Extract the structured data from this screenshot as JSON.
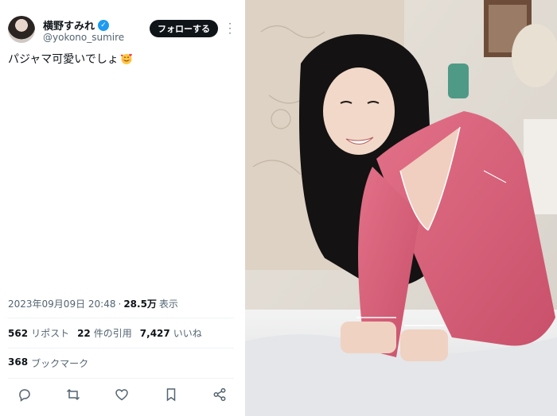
{
  "user": {
    "display_name": "横野すみれ",
    "handle": "@yokono_sumire",
    "verified_icon": "verified-badge-icon"
  },
  "follow_label": "フォローする",
  "tweet": {
    "text": "パジャマ可愛いでしょ",
    "emoji": "smiling-face-with-hearts"
  },
  "meta": {
    "timestamp": "2023年09月09日 20:48",
    "separator": "·",
    "views": "28.5万",
    "views_label": "表示"
  },
  "stats": {
    "reposts": "562",
    "reposts_label": "リポスト",
    "quotes": "22",
    "quotes_label": "件の引用",
    "likes": "7,427",
    "likes_label": "いいね"
  },
  "bookmarks": {
    "count": "368",
    "label": "ブックマーク"
  },
  "actions": [
    "reply-icon",
    "repost-icon",
    "like-icon",
    "bookmark-icon",
    "share-icon"
  ],
  "colors": {
    "accent": "#1d9bf0",
    "text": "#0f1419",
    "muted": "#536471",
    "pajama": "#d9607a"
  }
}
